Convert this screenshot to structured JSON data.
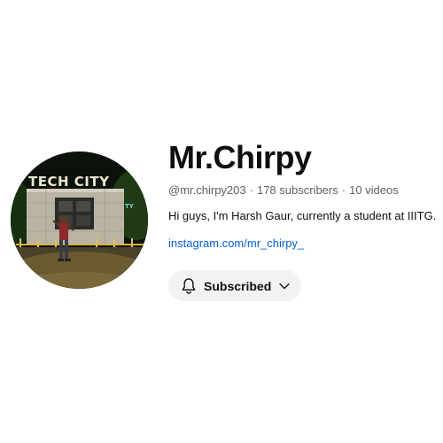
{
  "channel": {
    "name": "Mr.Chirpy",
    "handle": "@mr.chirpy203",
    "separator": "·",
    "subscribers": "178 subscribers",
    "videos": "10 videos",
    "description": "Hi guys, I'm Harsh Gaur, currently a student at IIITG.",
    "link": "instagram.com/mr_chirpy_"
  },
  "avatar": {
    "sign_text": "TECH CITY",
    "side_text": "TY"
  },
  "subscribe_button": {
    "label": "Subscribed",
    "icon": "bell-icon",
    "dropdown_icon": "chevron-down-icon",
    "background": "#f2f2f2"
  },
  "colors": {
    "link": "#065fd4",
    "meta": "#606060",
    "text": "#0f0f0f"
  }
}
